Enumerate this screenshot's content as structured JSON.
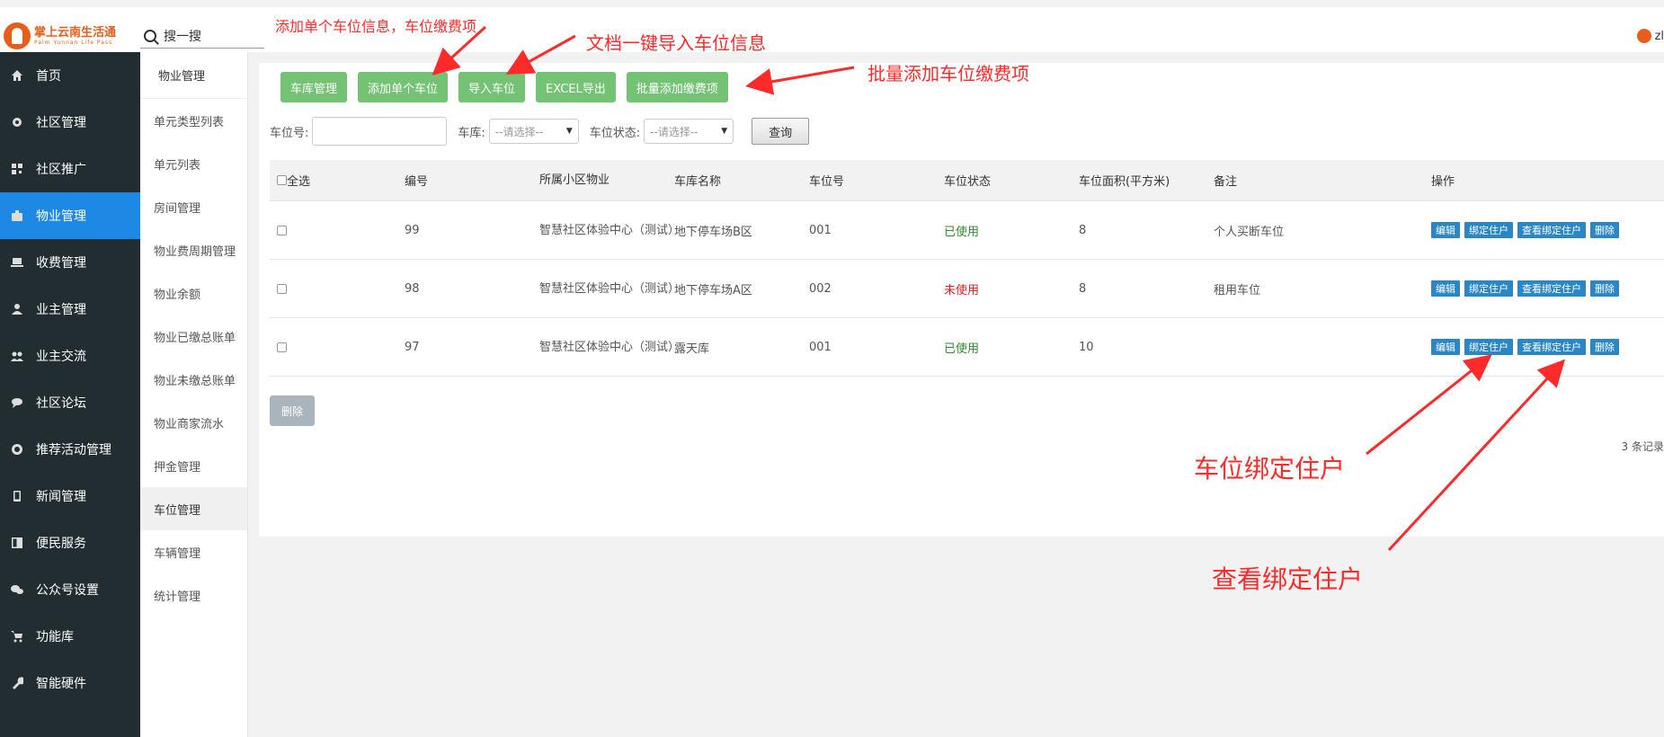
{
  "header": {
    "logo_cn": "掌上云南生活通",
    "logo_en": "Palm Yunnan Life Pass",
    "search_placeholder": "搜一搜",
    "user_name": "zl"
  },
  "sidebar": {
    "items": [
      {
        "label": "首页",
        "icon": "home-icon"
      },
      {
        "label": "社区管理",
        "icon": "gear-icon"
      },
      {
        "label": "社区推广",
        "icon": "qrcode-icon"
      },
      {
        "label": "物业管理",
        "icon": "briefcase-icon"
      },
      {
        "label": "收费管理",
        "icon": "laptop-icon"
      },
      {
        "label": "业主管理",
        "icon": "user-icon"
      },
      {
        "label": "业主交流",
        "icon": "users-icon"
      },
      {
        "label": "社区论坛",
        "icon": "comments-icon"
      },
      {
        "label": "推荐活动管理",
        "icon": "star-icon"
      },
      {
        "label": "新闻管理",
        "icon": "mobile-icon"
      },
      {
        "label": "便民服务",
        "icon": "columns-icon"
      },
      {
        "label": "公众号设置",
        "icon": "wechat-icon"
      },
      {
        "label": "功能库",
        "icon": "cart-icon"
      },
      {
        "label": "智能硬件",
        "icon": "wrench-icon"
      }
    ],
    "active_index": 3
  },
  "submenu": {
    "title": "物业管理",
    "items": [
      "单元类型列表",
      "单元列表",
      "房间管理",
      "物业费周期管理",
      "物业余额",
      "物业已缴总账单",
      "物业未缴总账单",
      "物业商家流水",
      "押金管理",
      "车位管理",
      "车辆管理",
      "统计管理"
    ],
    "active_index": 9
  },
  "toolbar": {
    "garage_manage": "车库管理",
    "add_single": "添加单个车位",
    "import": "导入车位",
    "excel_export": "EXCEL导出",
    "batch_fee": "批量添加缴费项"
  },
  "filter": {
    "spot_no_label": "车位号:",
    "spot_no_value": "",
    "garage_label": "车库:",
    "garage_selected": "--请选择--",
    "status_label": "车位状态:",
    "status_selected": "--请选择--",
    "query_button": "查询"
  },
  "table": {
    "headers": [
      "全选",
      "编号",
      "所属小区物业",
      "车库名称",
      "车位号",
      "车位状态",
      "车位面积(平方米)",
      "备注",
      "操作"
    ],
    "rows": [
      {
        "id": "99",
        "community": "智慧社区体验中心（测试）",
        "garage": "地下停车场B区",
        "spot": "001",
        "status": "已使用",
        "area": "8",
        "remark": "个人买断车位"
      },
      {
        "id": "98",
        "community": "智慧社区体验中心（测试）",
        "garage": "地下停车场A区",
        "spot": "002",
        "status": "未使用",
        "area": "8",
        "remark": "租用车位"
      },
      {
        "id": "97",
        "community": "智慧社区体验中心（测试）",
        "garage": "露天库",
        "spot": "001",
        "status": "已使用",
        "area": "10",
        "remark": ""
      }
    ],
    "actions": [
      "编辑",
      "绑定住户",
      "查看绑定住户",
      "删除"
    ]
  },
  "bottom": {
    "delete_button": "删除",
    "records": "3 条记录"
  },
  "annotations": {
    "add_single": "添加单个车位信息，车位缴费项",
    "import": "文档一键导入车位信息",
    "batch_fee": "批量添加车位缴费项",
    "bind": "车位绑定住户",
    "view_bind": "查看绑定住户"
  },
  "colors": {
    "accent": "#1e88e5",
    "sidebar_bg": "#222d32",
    "green_button": "#5cb85c",
    "action_button": "#2b86c5",
    "annotation": "#ff2a2a"
  }
}
